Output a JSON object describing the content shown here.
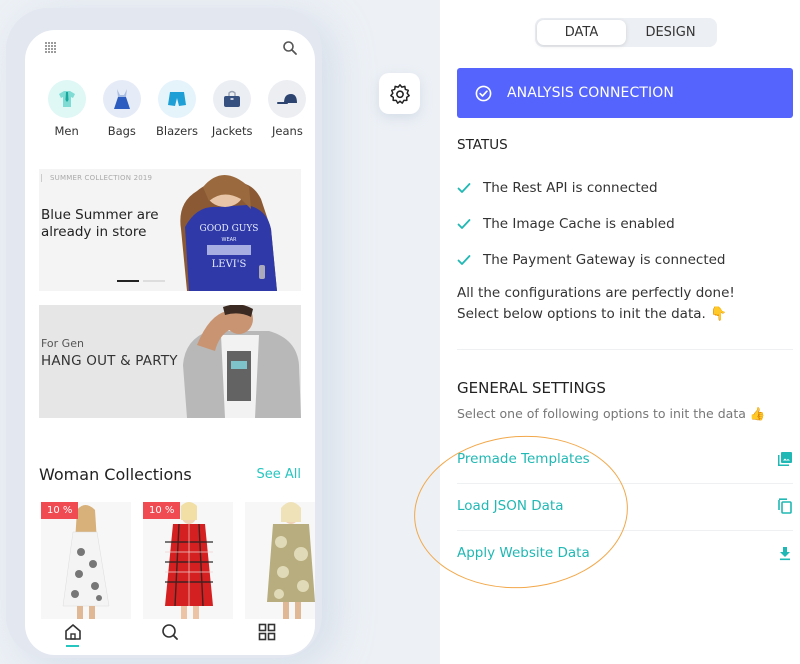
{
  "preview": {
    "categories": [
      {
        "label": "Men",
        "icon": "shirt-icon",
        "bg": "#dff7f5"
      },
      {
        "label": "Bags",
        "icon": "dress-icon",
        "bg": "#e6ecf7"
      },
      {
        "label": "Blazers",
        "icon": "shorts-icon",
        "bg": "#e5f3fb"
      },
      {
        "label": "Jackets",
        "icon": "handbag-icon",
        "bg": "#ebeef3"
      },
      {
        "label": "Jeans",
        "icon": "cap-icon",
        "bg": "#eceef2"
      }
    ],
    "banner1": {
      "tag": "SUMMER COLLECTION 2019",
      "title": "Blue Summer are already in store",
      "slides_total": 2,
      "slide_active": 1
    },
    "banner2": {
      "subtitle": "For Gen",
      "title": "HANG OUT & PARTY"
    },
    "section": {
      "title": "Woman Collections",
      "see_all": "See All"
    },
    "products": [
      {
        "badge": "10 %",
        "color": "white-print"
      },
      {
        "badge": "10 %",
        "color": "red-plaid"
      },
      {
        "badge": null,
        "color": "olive-print"
      }
    ],
    "bottom_nav": [
      {
        "icon": "home-icon",
        "active": true
      },
      {
        "icon": "search-icon",
        "active": false
      },
      {
        "icon": "grid-icon",
        "active": false
      }
    ]
  },
  "panel": {
    "tabs": [
      {
        "label": "DATA",
        "active": true
      },
      {
        "label": "DESIGN",
        "active": false
      }
    ],
    "connection": {
      "label": "ANALYSIS CONNECTION",
      "color": "#5464fd"
    },
    "status": {
      "heading": "STATUS",
      "items": [
        "The Rest API is connected",
        "The Image Cache is enabled",
        "The Payment Gateway is connected"
      ],
      "message": "All the configurations are perfectly done! Select below options to init the data. 👇"
    },
    "general": {
      "heading": "GENERAL SETTINGS",
      "subtitle": "Select one of following options to init the data 👍",
      "options": [
        {
          "label": "Premade Templates",
          "icon": "photo-library-icon"
        },
        {
          "label": "Load JSON Data",
          "icon": "copy-icon"
        },
        {
          "label": "Apply Website Data",
          "icon": "download-icon"
        }
      ]
    },
    "accent": "#20b8b4"
  }
}
